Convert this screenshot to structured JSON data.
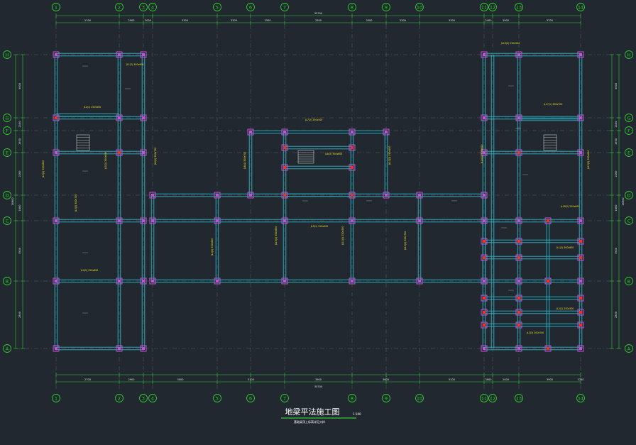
{
  "title": {
    "main": "地梁平法施工图",
    "scale": "1:100",
    "note": "基础梁顶上标高详见大样"
  },
  "colors": {
    "background": "#212830",
    "grid_axis": "#2ecc2e",
    "grid_line": "#8a8a8a",
    "beam": "#2fb7c7",
    "column": "#c94fd6",
    "annotation": "#f0e020",
    "highlight": "#ff2a2a",
    "text": "#e8e8e8"
  },
  "grid": {
    "vertical_axes": [
      "1",
      "2",
      "3",
      "4",
      "5",
      "6",
      "7",
      "8",
      "9",
      "10",
      "11",
      "12",
      "13",
      "14"
    ],
    "horizontal_axes": [
      "H",
      "G",
      "F",
      "E",
      "D",
      "C",
      "B",
      "A"
    ],
    "top_spans": [
      "2700",
      "2900",
      "3000",
      "3300",
      "3300",
      "3300",
      "3300",
      "3300",
      "3300",
      "3300",
      "2400",
      "3900",
      "3700"
    ],
    "bottom_spans": [
      "2700",
      "2900",
      "3000",
      "5100",
      "3900",
      "3600",
      "5100",
      "3900",
      "2400",
      "3900",
      "3700"
    ],
    "total_top": "35700",
    "total_bottom": "35700",
    "left_spans": [
      "3000",
      "2100",
      "1500",
      "2200",
      "1800",
      "3500",
      "2800"
    ],
    "left_total": "16900",
    "right_spans": [
      "3000",
      "2100",
      "1500",
      "2200",
      "1800",
      "3500",
      "2800"
    ],
    "right_total": "16900"
  },
  "beam_labels": [
    "JL1(2) 300x600",
    "JL2(1) 250x500",
    "JL3(3) 300x700",
    "JL4(2) 250x600",
    "JL5(1) 300x600",
    "JL6(4) 300x700",
    "JL7(2) 250x500",
    "JL8(3) 300x600",
    "JL9(1) 250x500",
    "JL10(2) 300x600",
    "JL11(1) 250x500",
    "JL12(2) 300x700",
    "JL13(2) 250x500",
    "JL14(1) 300x600",
    "JL15(3) 300x600",
    "JL16(2) 250x500",
    "JL17(1) 300x700",
    "JL18(2) 250x600"
  ]
}
